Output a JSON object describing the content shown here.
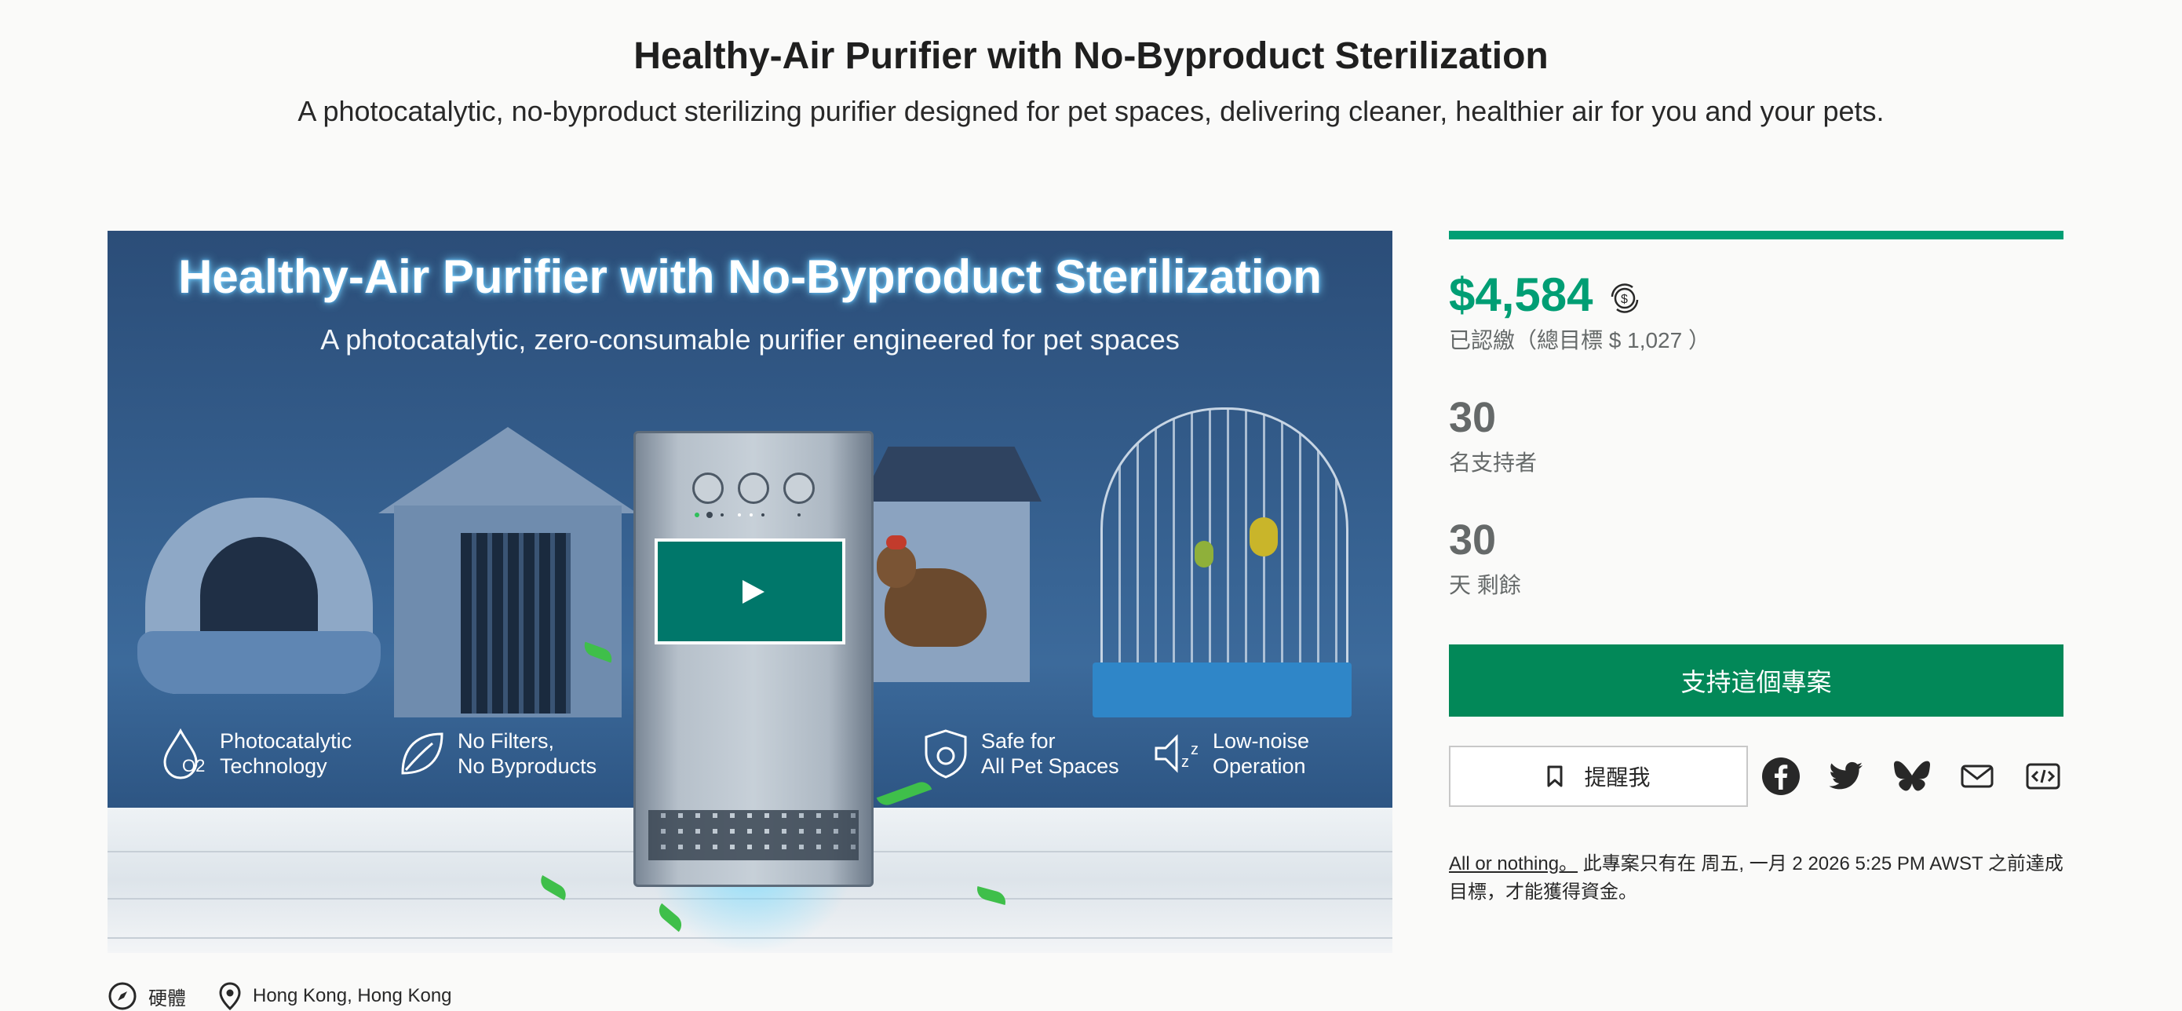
{
  "header": {
    "title": "Healthy-Air Purifier with No-Byproduct Sterilization",
    "blurb": "A photocatalytic, no-byproduct sterilizing purifier designed for pet spaces, delivering cleaner, healthier air for you and your pets."
  },
  "media": {
    "title": "Healthy-Air Purifier with No-Byproduct Sterilization",
    "subtitle": "A photocatalytic, zero-consumable purifier engineered for pet spaces",
    "play_icon": "play-icon",
    "features": [
      {
        "line1": "Photocatalytic",
        "line2": "Technology",
        "icon": "photocatalyst-drop-icon"
      },
      {
        "line1": "No Filters,",
        "line2": "No Byproducts",
        "icon": "leaf-icon"
      },
      {
        "line1": "Safe for",
        "line2": "All Pet Spaces",
        "icon": "shield-pet-icon"
      },
      {
        "line1": "Low-noise",
        "line2": "Operation",
        "icon": "zzz-sound-icon"
      }
    ]
  },
  "campaign": {
    "progress_fraction": 1.0,
    "pledged": "$4,584",
    "currency_icon": "currency-convert-icon",
    "pledged_label": "已認繳（總目標 $ 1,027 ）",
    "backers": "30",
    "backers_label": "名支持者",
    "days": "30",
    "days_label": "天 剩餘",
    "back_button": "支持這個專案",
    "remind_button": "提醒我",
    "share_icons": [
      "facebook-icon",
      "twitter-icon",
      "bluesky-icon",
      "email-icon",
      "embed-icon"
    ],
    "all_or_nothing": "All or nothing。",
    "funding_note": " 此專案只有在 周五, 一月 2 2026 5:25 PM AWST 之前達成目標，才能獲得資金。"
  },
  "meta": {
    "category": "硬體",
    "location": "Hong Kong, Hong Kong"
  },
  "colors": {
    "accent": "#009e74",
    "button": "#028858",
    "play": "#00776a"
  }
}
